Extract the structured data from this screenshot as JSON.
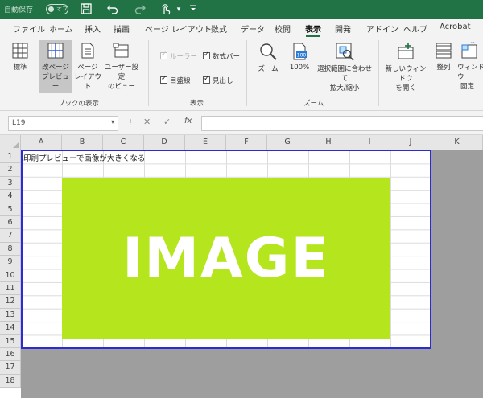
{
  "titlebar": {
    "autosave_label": "自動保存",
    "autosave_state": "オフ",
    "more_label": "▾"
  },
  "tabs": [
    "ファイル",
    "ホーム",
    "挿入",
    "描画",
    "ページ レイアウト",
    "数式",
    "データ",
    "校閲",
    "表示",
    "開発",
    "アドイン",
    "ヘルプ",
    "Acrobat"
  ],
  "active_tab": "表示",
  "ribbon": {
    "workbook_views": {
      "group_label": "ブックの表示",
      "normal": "標準",
      "page_break_preview": [
        "改ページ",
        "プレビュー"
      ],
      "page_layout": [
        "ページ",
        "レイアウト"
      ],
      "custom_views": [
        "ユーザー設定",
        "のビュー"
      ]
    },
    "show": {
      "group_label": "表示",
      "ruler": "ルーラー",
      "formula_bar": "数式バー",
      "gridlines": "目盛線",
      "headings": "見出し"
    },
    "zoom": {
      "group_label": "ズーム",
      "zoom": "ズーム",
      "hundred": "100%",
      "hundred_icon_text": "100",
      "zoom_to_selection": [
        "選択範囲に合わせて",
        "拡大/縮小"
      ]
    },
    "window": {
      "new_window": [
        "新しいウィンドウ",
        "を開く"
      ],
      "arrange_all": "整列",
      "freeze_panes": [
        "ウィンドウ",
        "固定"
      ]
    }
  },
  "formula_bar": {
    "name_box": "L19",
    "cancel": "✕",
    "enter": "✓",
    "fx": "fx",
    "value": ""
  },
  "grid": {
    "columns": [
      "A",
      "B",
      "C",
      "D",
      "E",
      "F",
      "G",
      "H",
      "I",
      "J",
      "K"
    ],
    "rows": [
      "1",
      "2",
      "3",
      "4",
      "5",
      "6",
      "7",
      "8",
      "9",
      "10",
      "11",
      "12",
      "13",
      "14",
      "15",
      "16",
      "17",
      "18"
    ],
    "a1": "印刷プレビューで画像が大きくなる"
  },
  "image": {
    "label": "IMAGE",
    "color": "#b5e61d"
  },
  "colors": {
    "excel_green": "#217346",
    "print_area_border": "#2b2bd6"
  }
}
